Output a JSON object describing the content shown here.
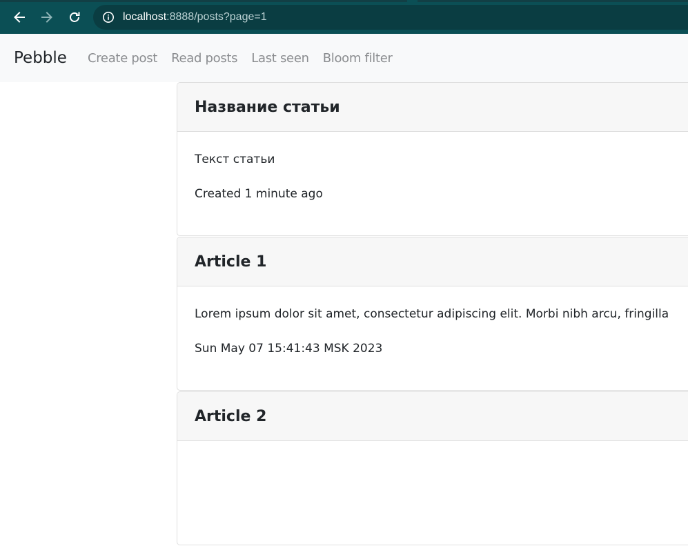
{
  "browser": {
    "url_host": "localhost",
    "url_rest": ":8888/posts?page=1",
    "icons": {
      "back": "arrow-left-icon",
      "forward": "arrow-right-icon",
      "reload": "reload-icon",
      "site_info": "info-icon"
    }
  },
  "navbar": {
    "brand": "Pebble",
    "links": [
      {
        "label": "Create post"
      },
      {
        "label": "Read posts"
      },
      {
        "label": "Last seen"
      },
      {
        "label": "Bloom filter"
      }
    ]
  },
  "posts": [
    {
      "title": "Название статьи",
      "text": "Текст статьи",
      "meta": "Created 1 minute ago"
    },
    {
      "title": "Article 1",
      "text": "Lorem ipsum dolor sit amet, consectetur adipiscing elit. Morbi nibh arcu, fringilla",
      "meta": "Sun May 07 15:41:43 MSK 2023"
    },
    {
      "title": "Article 2"
    }
  ],
  "colors": {
    "browser_toolbar": "#0b4f55",
    "omnibox": "#0a3d42",
    "navbar_bg": "#f8f9fa",
    "nav_link": "#8a8c8f",
    "card_header": "#f7f7f7",
    "card_border": "#dfdfdf",
    "text": "#212529"
  }
}
